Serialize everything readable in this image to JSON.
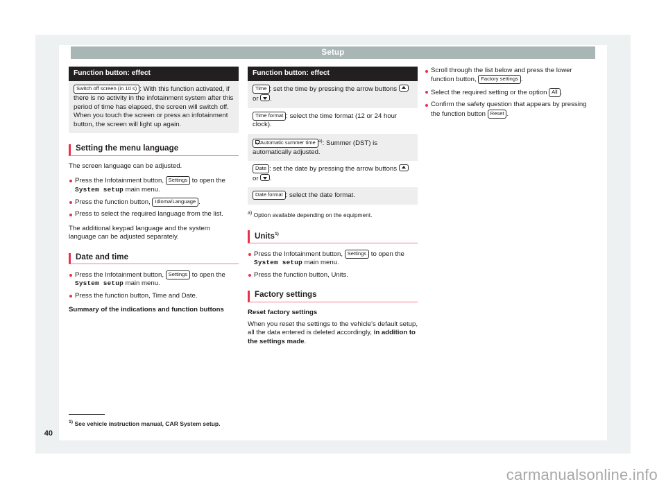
{
  "header": {
    "title": "Setup"
  },
  "page_number": "40",
  "watermark": "carmanualsonline.info",
  "colors": {
    "accent_red": "#e8304a",
    "header_band": "#a8b6b6",
    "table_header": "#231f20",
    "zebra_row": "#eeeeee",
    "backdrop": "#eef1f2"
  },
  "column_1": {
    "table": {
      "header": "Function button: effect",
      "rows": [
        {
          "key": "Switch off screen (in 10 s)",
          "text": ": With this function activated, if there is no activity in the infotainment system after this period of time has elapsed, the screen will switch off. When you touch the screen or press an infotainment button, the screen will light up again."
        }
      ]
    },
    "section_language": {
      "heading": "Setting the menu language",
      "intro": "The screen language can be adjusted.",
      "bullets": [
        {
          "pre": "Press the Infotainment button, ",
          "key": "Settings",
          "mid": " to open the ",
          "mono": "System setup",
          "post": " main menu."
        },
        {
          "pre": "Press the function button, ",
          "key": "Idioma/Language",
          "post": "."
        },
        {
          "pre": "Press to select the required language from the list."
        }
      ],
      "outro": "The additional keypad language and the system language can be adjusted separately."
    },
    "section_datetime": {
      "heading": "Date and time",
      "bullets": [
        {
          "pre": "Press the Infotainment button, ",
          "key": "Settings",
          "mid": " to open the ",
          "mono": "System setup",
          "post": " main menu."
        },
        {
          "pre": "Press the function button, Time and Date."
        }
      ],
      "subhead": "Summary of the indications and function buttons"
    }
  },
  "column_2": {
    "table": {
      "header": "Function button: effect",
      "rows": [
        {
          "key": "Time",
          "text": ": set the time by pressing the arrow buttons",
          "has_arrows": true,
          "tail": "."
        },
        {
          "key": "Time format",
          "text": ": select the time format (12 or 24 hour clock)."
        },
        {
          "key": "Automatic summer time",
          "checkbox": true,
          "footnote": "a)",
          "text": ": Summer (DST) is automatically adjusted."
        },
        {
          "key": "Date",
          "text": ": set the date by pressing the arrow buttons",
          "has_arrows": true,
          "tail": "."
        },
        {
          "key": "Date format",
          "text": ": select the date format."
        }
      ],
      "footnote": {
        "marker": "a)",
        "text": "Option available depending on the equipment."
      }
    },
    "section_units": {
      "heading": "Units",
      "heading_footnote": "1)",
      "bullets": [
        {
          "pre": "Press the Infotainment button, ",
          "key": "Settings",
          "mid": " to open the ",
          "mono": "System setup",
          "post": " main menu."
        },
        {
          "pre": "Press the function button, Units."
        }
      ]
    },
    "section_factory": {
      "heading": "Factory settings",
      "subhead": "Reset factory settings",
      "body_pre": "When you reset the settings to the vehicle's default setup, all the data entered is deleted accordingly, ",
      "body_bold": "in addition to the settings made",
      "body_post": "."
    }
  },
  "column_3": {
    "bullets": [
      {
        "pre": "Scroll through the list below and press the lower function button, ",
        "key": "Factory settings",
        "post": "."
      },
      {
        "pre": "Select the required setting or the option ",
        "key": "All",
        "post": "."
      },
      {
        "pre": "Confirm the safety question that appears by pressing the function button ",
        "key": "Reset",
        "post": "."
      }
    ]
  },
  "bottom_footnote": {
    "marker": "1)",
    "text": "See vehicle instruction manual, CAR System setup."
  }
}
